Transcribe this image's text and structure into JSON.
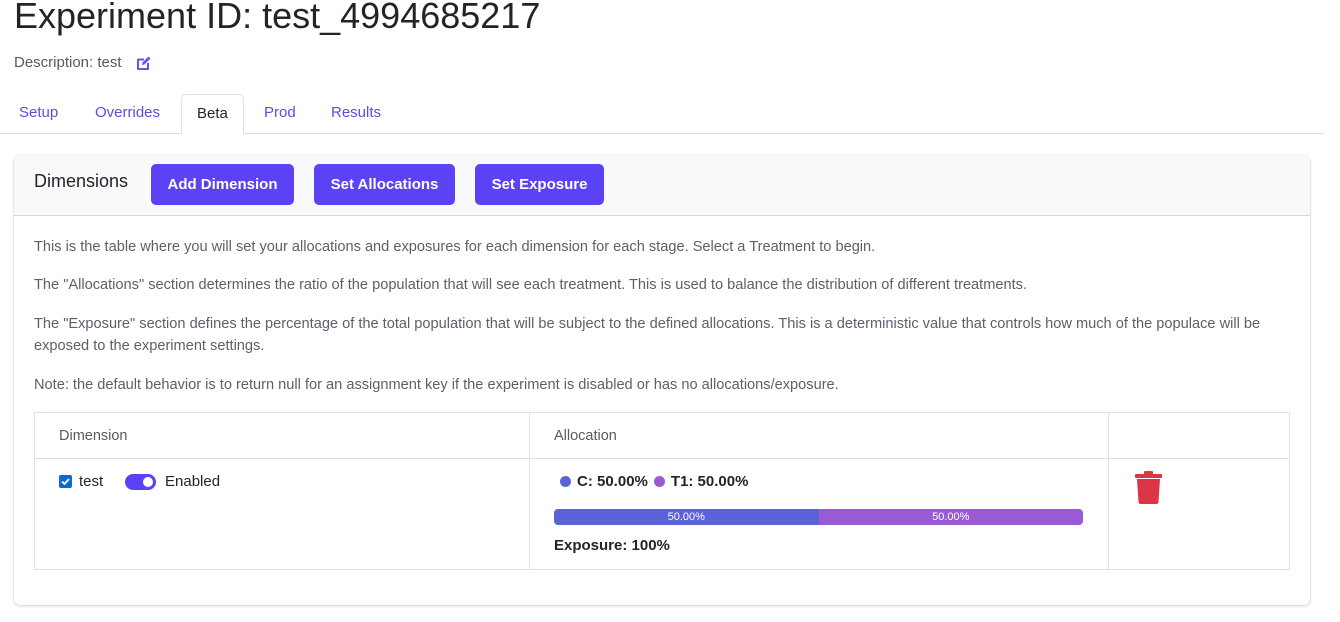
{
  "page": {
    "title": "Experiment ID: test_4994685217",
    "description": "Description: test"
  },
  "tabs": [
    {
      "label": "Setup"
    },
    {
      "label": "Overrides"
    },
    {
      "label": "Beta"
    },
    {
      "label": "Prod"
    },
    {
      "label": "Results"
    }
  ],
  "active_tab": "Beta",
  "card": {
    "title": "Dimensions",
    "buttons": {
      "add_dimension": "Add Dimension",
      "set_allocations": "Set Allocations",
      "set_exposure": "Set Exposure"
    },
    "paragraphs": [
      "This is the table where you will set your allocations and exposures for each dimension for each stage. Select a Treatment to begin.",
      "The \"Allocations\" section determines the ratio of the population that will see each treatment. This is used to balance the distribution of different treatments.",
      "The \"Exposure\" section defines the percentage of the total population that will be subject to the defined allocations. This is a deterministic value that controls how much of the populace will be exposed to the experiment settings.",
      "Note: the default behavior is to return null for an assignment key if the experiment is disabled or has no allocations/exposure."
    ]
  },
  "table": {
    "headers": [
      "Dimension",
      "Allocation",
      ""
    ],
    "rows": [
      {
        "dimension": "test",
        "checked": true,
        "enabled": true,
        "enabled_label": "Enabled",
        "allocations": [
          {
            "name": "C",
            "label": "C: 50.00%",
            "fraction": 0.5,
            "bar_label": "50.00%",
            "color": "#5a62d8"
          },
          {
            "name": "T1",
            "label": "T1: 50.00%",
            "fraction": 0.5,
            "bar_label": "50.00%",
            "color": "#9a5ad4"
          }
        ],
        "exposure": "Exposure: 100%"
      }
    ]
  },
  "colors": {
    "primary": "#5b43f5",
    "link": "#5b4de0",
    "danger": "#dc3545"
  },
  "icons": {
    "edit": "edit-icon",
    "delete": "trash-icon",
    "check": "checkmark-icon"
  }
}
